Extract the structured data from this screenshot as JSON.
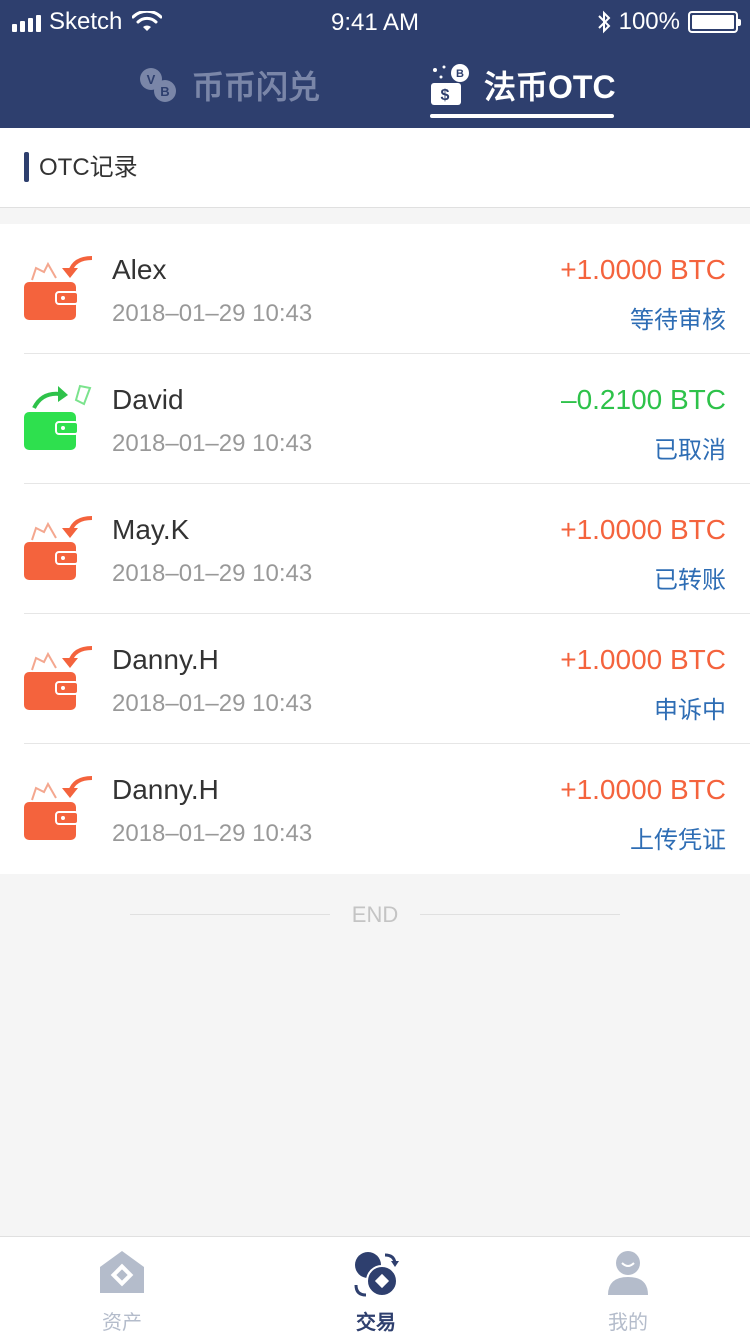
{
  "status_bar": {
    "carrier": "Sketch",
    "time": "9:41 AM",
    "battery": "100%"
  },
  "tabs": [
    {
      "label": "币币闪兑",
      "active": false,
      "icon": "coin-exchange-icon"
    },
    {
      "label": "法币OTC",
      "active": true,
      "icon": "fiat-otc-icon"
    }
  ],
  "section": {
    "title": "OTC记录"
  },
  "records": [
    {
      "name": "Alex",
      "date": "2018–01–29 10:43",
      "amount": "+1.0000 BTC",
      "direction": "in",
      "status": "等待审核"
    },
    {
      "name": "David",
      "date": "2018–01–29 10:43",
      "amount": "–0.2100 BTC",
      "direction": "out",
      "status": "已取消"
    },
    {
      "name": "May.K",
      "date": "2018–01–29 10:43",
      "amount": "+1.0000 BTC",
      "direction": "in",
      "status": "已转账"
    },
    {
      "name": "Danny.H",
      "date": "2018–01–29 10:43",
      "amount": "+1.0000 BTC",
      "direction": "in",
      "status": "申诉中"
    },
    {
      "name": "Danny.H",
      "date": "2018–01–29 10:43",
      "amount": "+1.0000 BTC",
      "direction": "in",
      "status": "上传凭证"
    }
  ],
  "end_label": "END",
  "bottom_nav": [
    {
      "label": "资产",
      "icon": "assets-icon",
      "active": false
    },
    {
      "label": "交易",
      "icon": "trade-icon",
      "active": true
    },
    {
      "label": "我的",
      "icon": "profile-icon",
      "active": false
    }
  ],
  "colors": {
    "header_bg": "#2e3f6e",
    "incoming": "#f4633d",
    "outgoing": "#2ec24a",
    "status_text": "#2e6db4"
  }
}
